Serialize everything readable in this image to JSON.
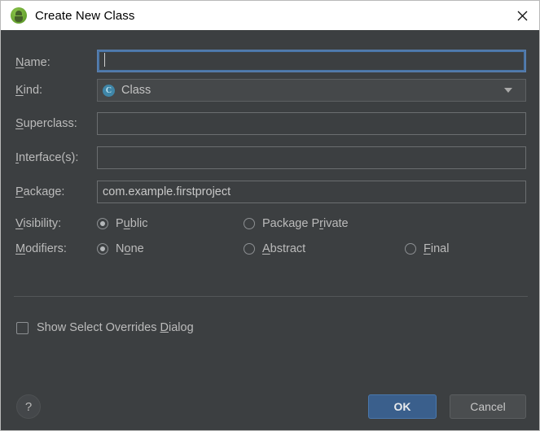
{
  "window": {
    "title": "Create New Class",
    "icon": "android-studio-icon",
    "close_label": "close-icon"
  },
  "form": {
    "fields": [
      {
        "label_pre": "",
        "label_mn": "N",
        "label_post": "ame:",
        "value": "",
        "type": "text",
        "focused": true
      },
      {
        "label_pre": "",
        "label_mn": "K",
        "label_post": "ind:",
        "value": "Class",
        "type": "combo",
        "icon_letter": "C"
      },
      {
        "label_pre": "",
        "label_mn": "S",
        "label_post": "uperclass:",
        "value": "",
        "type": "text",
        "focused": false
      },
      {
        "label_pre": "",
        "label_mn": "I",
        "label_post": "nterface(s):",
        "value": "",
        "type": "text",
        "focused": false
      },
      {
        "label_pre": "",
        "label_mn": "P",
        "label_post": "ackage:",
        "value": "com.example.firstproject",
        "type": "text",
        "focused": false
      }
    ],
    "visibility": {
      "label_mn": "V",
      "label_post": "isibility:",
      "options": [
        {
          "pre": "P",
          "mn": "u",
          "post": "blic",
          "selected": true
        },
        {
          "pre": "Package P",
          "mn": "r",
          "post": "ivate",
          "selected": false
        }
      ]
    },
    "modifiers": {
      "label_mn": "M",
      "label_post": "odifiers:",
      "options": [
        {
          "pre": "N",
          "mn": "o",
          "post": "ne",
          "selected": true
        },
        {
          "pre": "",
          "mn": "A",
          "post": "bstract",
          "selected": false
        },
        {
          "pre": "",
          "mn": "F",
          "post": "inal",
          "selected": false
        }
      ]
    },
    "show_overrides": {
      "pre": "Show Select Overrides ",
      "mn": "D",
      "post": "ialog",
      "checked": false
    }
  },
  "footer": {
    "help_label": "?",
    "ok_label": "OK",
    "cancel_label": "Cancel"
  },
  "colors": {
    "dialog_bg": "#3c3f41",
    "titlebar_bg": "#ffffff",
    "accent_focus": "#4a76a8",
    "ok_button": "#3a5f8c",
    "kind_icon": "#3f86a8",
    "app_icon_green": "#6aa632",
    "text": "#bbbbbb"
  }
}
